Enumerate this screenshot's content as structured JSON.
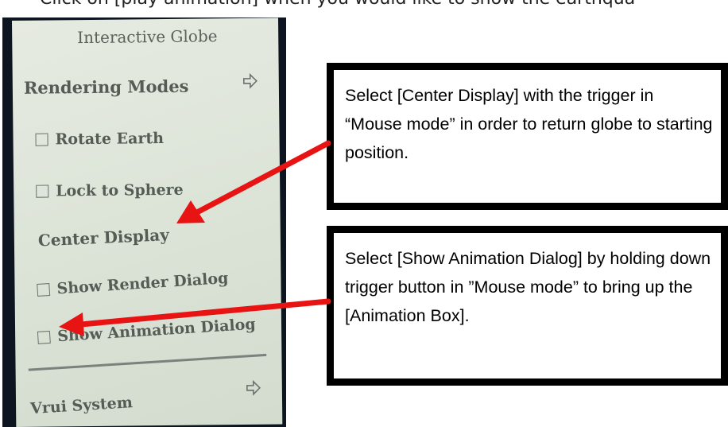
{
  "top_text": {
    "bullet": "•",
    "text": "Click on [play animation] when you would like to show the earthqua"
  },
  "menu": {
    "title": "Interactive Globe",
    "items": [
      {
        "label": "Rendering Modes",
        "type": "submenu"
      },
      {
        "label": "Rotate Earth",
        "type": "checkbox",
        "checked": false
      },
      {
        "label": "Lock to Sphere",
        "type": "checkbox",
        "checked": false
      },
      {
        "label": "Center Display",
        "type": "button"
      },
      {
        "label": "Show Render Dialog",
        "type": "checkbox",
        "checked": false
      },
      {
        "label": "Show Animation Dialog",
        "type": "checkbox",
        "checked": false
      },
      {
        "label": "Vrui System",
        "type": "submenu"
      }
    ]
  },
  "callouts": [
    {
      "text": "Select [Center Display] with the trigger in “Mouse mode” in order to return globe to starting position."
    },
    {
      "text": "Select [Show Animation Dialog] by holding down trigger button in ”Mouse mode” to bring up the [Animation Box]."
    }
  ],
  "colors": {
    "arrow": "#e81414",
    "callout_border": "#000000",
    "menu_background": "#dfe5da",
    "menu_text": "#555c56"
  },
  "icons": {
    "submenu_arrow": "arrow-right-outline-icon",
    "checkbox": "checkbox-unchecked-icon"
  }
}
